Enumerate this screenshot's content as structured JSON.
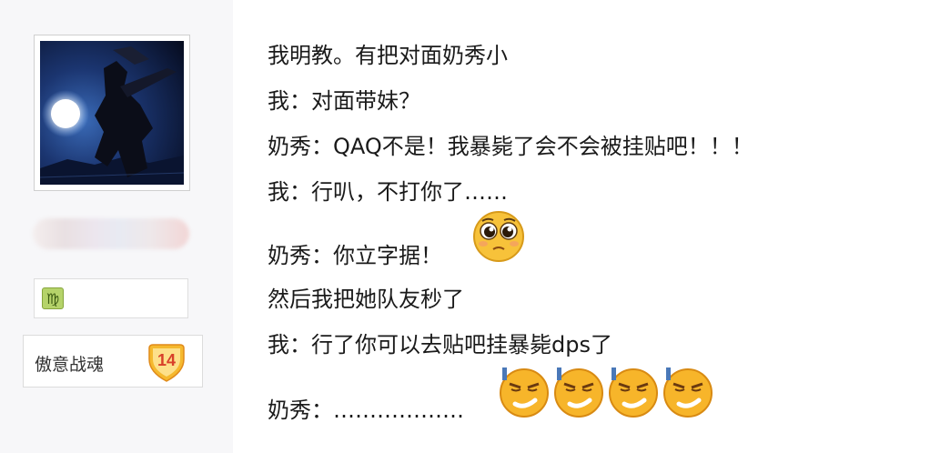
{
  "sidebar": {
    "rank_title": "傲意战魂",
    "rank_level": "14",
    "zodiac_icon": "virgo-icon",
    "zodiac_glyph": "♍"
  },
  "messages": [
    "我明教。有把对面奶秀小",
    "我：对面带妹？",
    "奶秀：QAQ不是！我暴毙了会不会被挂贴吧！！！",
    "我：行叭，不打你了……",
    "奶秀：你立字据！",
    "然后我把她队友秒了",
    "我：行了你可以去贴吧挂暴毙dps了",
    "奶秀：………………"
  ],
  "emojis": {
    "pleading_face": "pleading-face-icon",
    "smug_face": "smug-face-icon"
  },
  "colors": {
    "sidebar_bg": "#f7f7f9",
    "text": "#1a1a1a",
    "badge_gold": "#f5b92e",
    "badge_red": "#d8402a"
  }
}
